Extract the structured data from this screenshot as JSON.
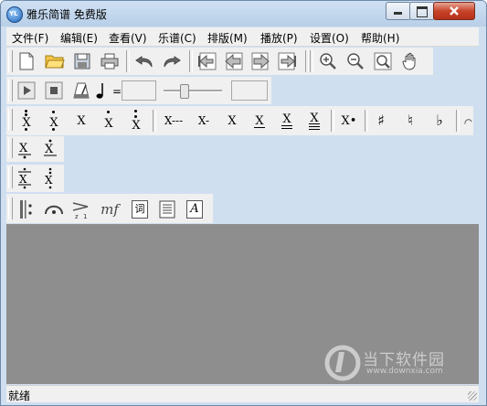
{
  "window": {
    "title": "雅乐简谱 免费版",
    "app_icon_text": "YL"
  },
  "menu": [
    {
      "label": "文件(F)"
    },
    {
      "label": "编辑(E)"
    },
    {
      "label": "查看(V)"
    },
    {
      "label": "乐谱(C)"
    },
    {
      "label": "排版(M)"
    },
    {
      "label": "播放(P)"
    },
    {
      "label": "设置(O)"
    },
    {
      "label": "帮助(H)"
    }
  ],
  "playback": {
    "tempo_equals": "=",
    "tempo_value": "",
    "position_value": "",
    "slider_level": 0.35
  },
  "notes_toolbar": {
    "symbols": [
      "X",
      "X",
      "X",
      "X",
      "X",
      "X---",
      "X-",
      "X",
      "X",
      "X",
      "X",
      "X•",
      "♯",
      "♮",
      "♭"
    ]
  },
  "format_toolbar": {
    "lyric_label": "词",
    "text_label": "A",
    "dynamic_label": "mf"
  },
  "status": {
    "text": "就绪"
  },
  "watermark": {
    "text": "当下软件园",
    "url": "www.downxia.com"
  },
  "colors": {
    "canvas": "#8e8e8e",
    "toolbar": "#f0f0f0",
    "title_bg": "#c3d6ec",
    "close": "#c7442b"
  }
}
